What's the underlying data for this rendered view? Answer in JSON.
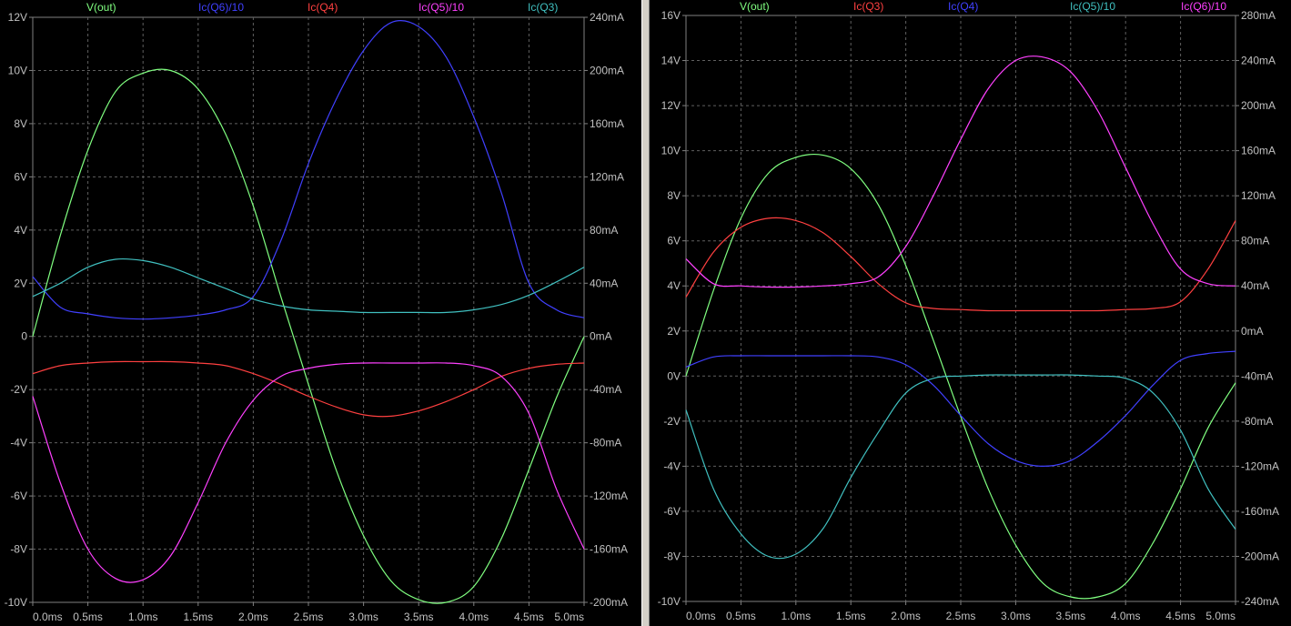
{
  "window": {
    "app": "LTspice waveform viewer"
  },
  "chart_data": [
    {
      "type": "line",
      "pane": "left",
      "background": "#000000",
      "grid": true,
      "x": {
        "unit": "ms",
        "range": [
          0,
          5
        ],
        "ticks": [
          "0.0ms",
          "0.5ms",
          "1.0ms",
          "1.5ms",
          "2.0ms",
          "2.5ms",
          "3.0ms",
          "3.5ms",
          "4.0ms",
          "4.5ms",
          "5.0ms"
        ]
      },
      "y_left": {
        "unit": "V",
        "range": [
          -10,
          12
        ],
        "ticks": [
          "-10V",
          "-8V",
          "-6V",
          "-4V",
          "-2V",
          "0",
          "2V",
          "4V",
          "6V",
          "8V",
          "10V",
          "12V"
        ]
      },
      "y_right": {
        "unit": "mA",
        "range": [
          -200,
          240
        ],
        "ticks": [
          "-200mA",
          "-160mA",
          "-120mA",
          "-80mA",
          "-40mA",
          "0mA",
          "40mA",
          "80mA",
          "120mA",
          "160mA",
          "200mA",
          "240mA"
        ]
      },
      "series": [
        {
          "name": "V(out)",
          "color": "#80ff80",
          "axis": "left",
          "x": [
            0,
            0.25,
            0.5,
            0.75,
            1.0,
            1.25,
            1.5,
            1.75,
            2.0,
            2.25,
            2.5,
            2.75,
            3.0,
            3.25,
            3.5,
            3.75,
            4.0,
            4.25,
            4.5,
            4.75,
            5.0
          ],
          "y": [
            0,
            3.8,
            7.0,
            9.2,
            9.9,
            10.0,
            9.3,
            7.6,
            4.9,
            1.5,
            -1.8,
            -5.0,
            -7.5,
            -9.2,
            -9.9,
            -10.0,
            -9.4,
            -7.6,
            -5.0,
            -2.3,
            0
          ]
        },
        {
          "name": "Ic(Q6)/10",
          "color": "#4040ff",
          "axis": "right",
          "x": [
            0,
            0.25,
            0.5,
            0.75,
            1.0,
            1.25,
            1.5,
            1.75,
            2.0,
            2.25,
            2.5,
            2.75,
            3.0,
            3.25,
            3.5,
            3.75,
            4.0,
            4.25,
            4.5,
            4.75,
            5.0
          ],
          "y": [
            45,
            22,
            17,
            14,
            13,
            14,
            16,
            20,
            30,
            72,
            130,
            178,
            215,
            236,
            233,
            210,
            165,
            108,
            40,
            20,
            14
          ]
        },
        {
          "name": "Ic(Q4)",
          "color": "#ff4040",
          "axis": "right",
          "x": [
            0,
            0.25,
            0.5,
            0.75,
            1.0,
            1.25,
            1.5,
            1.75,
            2.0,
            2.25,
            2.5,
            2.75,
            3.0,
            3.25,
            3.5,
            3.75,
            4.0,
            4.25,
            4.5,
            4.75,
            5.0
          ],
          "y": [
            -28,
            -22,
            -20,
            -19,
            -19,
            -19,
            -20,
            -22,
            -28,
            -36,
            -45,
            -53,
            -59,
            -60,
            -56,
            -49,
            -40,
            -30,
            -24,
            -21,
            -20
          ]
        },
        {
          "name": "Ic(Q5)/10",
          "color": "#ff40ff",
          "axis": "right",
          "x": [
            0,
            0.25,
            0.5,
            0.75,
            1.0,
            1.25,
            1.5,
            1.75,
            2.0,
            2.25,
            2.5,
            2.75,
            3.0,
            3.25,
            3.5,
            3.75,
            4.0,
            4.25,
            4.5,
            4.75,
            5.0
          ],
          "y": [
            -45,
            -110,
            -160,
            -182,
            -183,
            -165,
            -125,
            -80,
            -48,
            -30,
            -24,
            -21,
            -20,
            -20,
            -20,
            -20,
            -22,
            -30,
            -58,
            -115,
            -160
          ]
        },
        {
          "name": "Ic(Q3)",
          "color": "#40c0c0",
          "axis": "right",
          "x": [
            0,
            0.25,
            0.5,
            0.75,
            1.0,
            1.25,
            1.5,
            1.75,
            2.0,
            2.25,
            2.5,
            2.75,
            3.0,
            3.25,
            3.5,
            3.75,
            4.0,
            4.25,
            4.5,
            4.75,
            5.0
          ],
          "y": [
            30,
            40,
            52,
            58,
            57,
            52,
            44,
            36,
            28,
            23,
            20,
            19,
            18,
            18,
            18,
            18,
            20,
            24,
            31,
            41,
            52
          ]
        }
      ]
    },
    {
      "type": "line",
      "pane": "right",
      "background": "#000000",
      "grid": true,
      "x": {
        "unit": "ms",
        "range": [
          0,
          5
        ],
        "ticks": [
          "0.0ms",
          "0.5ms",
          "1.0ms",
          "1.5ms",
          "2.0ms",
          "2.5ms",
          "3.0ms",
          "3.5ms",
          "4.0ms",
          "4.5ms",
          "5.0ms"
        ]
      },
      "y_left": {
        "unit": "V",
        "range": [
          -10,
          16
        ],
        "ticks": [
          "-10V",
          "-8V",
          "-6V",
          "-4V",
          "-2V",
          "0V",
          "2V",
          "4V",
          "6V",
          "8V",
          "10V",
          "12V",
          "14V",
          "16V"
        ]
      },
      "y_right": {
        "unit": "mA",
        "range": [
          -240,
          280
        ],
        "ticks": [
          "-240mA",
          "-200mA",
          "-160mA",
          "-120mA",
          "-80mA",
          "-40mA",
          "0mA",
          "40mA",
          "80mA",
          "120mA",
          "160mA",
          "200mA",
          "240mA",
          "280mA"
        ]
      },
      "series": [
        {
          "name": "V(out)",
          "color": "#80ff80",
          "axis": "left",
          "x": [
            0,
            0.25,
            0.5,
            0.75,
            1.0,
            1.25,
            1.5,
            1.75,
            2.0,
            2.25,
            2.5,
            2.75,
            3.0,
            3.25,
            3.5,
            3.75,
            4.0,
            4.25,
            4.5,
            4.75,
            5.0
          ],
          "y": [
            0,
            3.8,
            7.0,
            9.0,
            9.7,
            9.8,
            9.2,
            7.6,
            4.9,
            1.6,
            -1.8,
            -5.0,
            -7.5,
            -9.2,
            -9.8,
            -9.8,
            -9.2,
            -7.4,
            -5.0,
            -2.3,
            -0.3
          ]
        },
        {
          "name": "Ic(Q3)",
          "color": "#ff4040",
          "axis": "right",
          "x": [
            0,
            0.25,
            0.5,
            0.75,
            1.0,
            1.25,
            1.5,
            1.75,
            2.0,
            2.25,
            2.5,
            2.75,
            3.0,
            3.25,
            3.5,
            3.75,
            4.0,
            4.25,
            4.5,
            4.75,
            5.0
          ],
          "y": [
            30,
            70,
            92,
            100,
            98,
            87,
            66,
            42,
            25,
            20,
            19,
            18,
            18,
            18,
            18,
            18,
            19,
            20,
            26,
            55,
            98
          ]
        },
        {
          "name": "Ic(Q4)",
          "color": "#4040ff",
          "axis": "right",
          "x": [
            0,
            0.25,
            0.5,
            0.75,
            1.0,
            1.25,
            1.5,
            1.75,
            2.0,
            2.25,
            2.5,
            2.75,
            3.0,
            3.25,
            3.5,
            3.75,
            4.0,
            4.25,
            4.5,
            4.75,
            5.0
          ],
          "y": [
            -32,
            -23,
            -22,
            -22,
            -22,
            -22,
            -22,
            -23,
            -30,
            -48,
            -75,
            -100,
            -115,
            -120,
            -115,
            -98,
            -75,
            -48,
            -26,
            -20,
            -18
          ]
        },
        {
          "name": "Ic(Q5)/10",
          "color": "#40c0c0",
          "axis": "right",
          "x": [
            0,
            0.25,
            0.5,
            0.75,
            1.0,
            1.25,
            1.5,
            1.75,
            2.0,
            2.25,
            2.5,
            2.75,
            3.0,
            3.25,
            3.5,
            3.75,
            4.0,
            4.25,
            4.5,
            4.75,
            5.0
          ],
          "y": [
            -70,
            -140,
            -180,
            -200,
            -198,
            -175,
            -130,
            -90,
            -55,
            -42,
            -40,
            -39,
            -39,
            -39,
            -39,
            -40,
            -42,
            -55,
            -88,
            -140,
            -176
          ]
        },
        {
          "name": "Ic(Q6)/10",
          "color": "#ff40ff",
          "axis": "right",
          "x": [
            0,
            0.25,
            0.5,
            0.75,
            1.0,
            1.25,
            1.5,
            1.75,
            2.0,
            2.25,
            2.5,
            2.75,
            3.0,
            3.25,
            3.5,
            3.75,
            4.0,
            4.25,
            4.5,
            4.75,
            5.0
          ],
          "y": [
            64,
            42,
            40,
            39,
            39,
            40,
            42,
            48,
            75,
            120,
            170,
            215,
            240,
            243,
            230,
            195,
            145,
            95,
            55,
            42,
            40
          ]
        }
      ]
    }
  ]
}
